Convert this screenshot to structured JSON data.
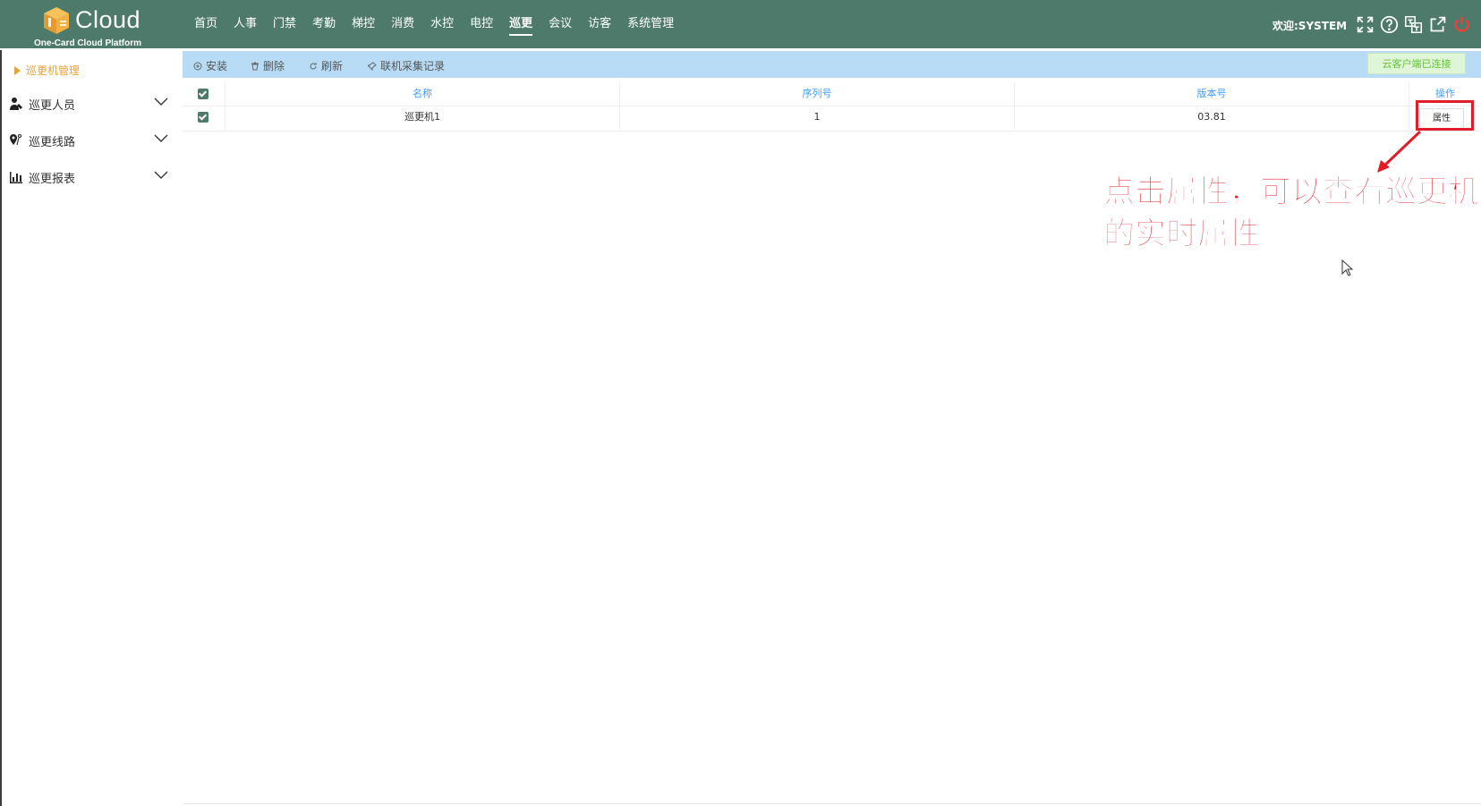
{
  "app": {
    "brand": "Cloud",
    "subtitle": "One-Card Cloud Platform",
    "welcome": "欢迎:SYSTEM"
  },
  "nav": [
    {
      "label": "首页",
      "active": false
    },
    {
      "label": "人事",
      "active": false
    },
    {
      "label": "门禁",
      "active": false
    },
    {
      "label": "考勤",
      "active": false
    },
    {
      "label": "梯控",
      "active": false
    },
    {
      "label": "消费",
      "active": false
    },
    {
      "label": "水控",
      "active": false
    },
    {
      "label": "电控",
      "active": false
    },
    {
      "label": "巡更",
      "active": true
    },
    {
      "label": "会议",
      "active": false
    },
    {
      "label": "访客",
      "active": false
    },
    {
      "label": "系统管理",
      "active": false
    }
  ],
  "top_icons": [
    "fullscreen-icon",
    "help-icon",
    "language-icon",
    "external-link-icon",
    "power-icon"
  ],
  "sidebar": {
    "active_item": "巡更机管理",
    "items": [
      {
        "label": "巡更人员",
        "icon": "user-icon"
      },
      {
        "label": "巡更线路",
        "icon": "map-pin-icon"
      },
      {
        "label": "巡更报表",
        "icon": "bar-chart-icon"
      }
    ]
  },
  "toolbar": {
    "install": "安装",
    "delete": "删除",
    "refresh": "刷新",
    "collect_records": "联机采集记录",
    "connection_status": "云客户端已连接"
  },
  "table": {
    "headers": {
      "name": "名称",
      "serial": "序列号",
      "version": "版本号",
      "action": "操作"
    },
    "rows": [
      {
        "name": "巡更机1",
        "serial": "1",
        "version": "03.81",
        "action": "属性",
        "checked": true
      }
    ]
  },
  "annotation": {
    "text": "点击属性，可以查看巡更机的实时属性",
    "color": "#e11d2a"
  },
  "colors": {
    "topbar": "#4d7a6b",
    "toolbar": "#b8dcf5",
    "accent": "#e6a23c",
    "header_text": "#409eff",
    "connected": "#67c23a"
  }
}
